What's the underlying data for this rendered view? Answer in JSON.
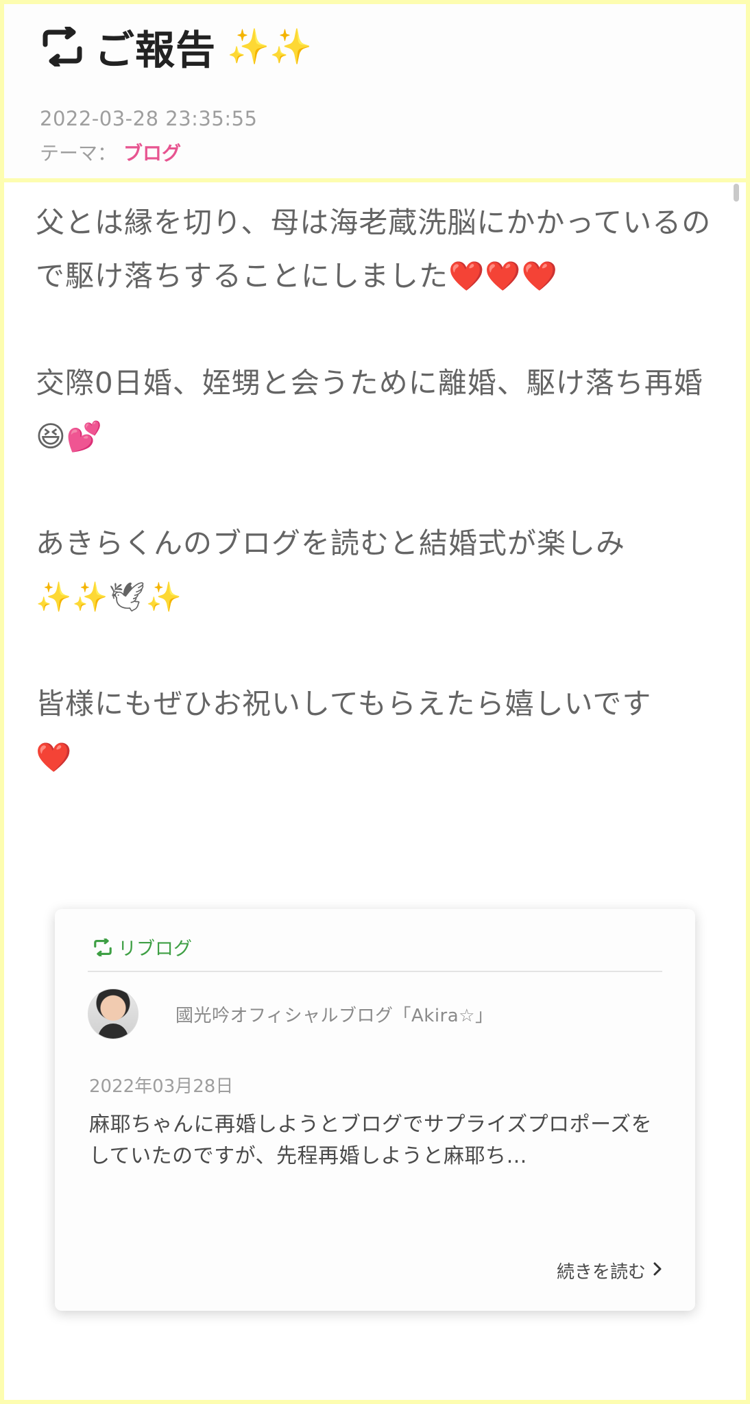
{
  "post": {
    "title": "ご報告",
    "title_sparkles": "✨✨",
    "date": "2022-03-28 23:35:55",
    "theme_label": "テーマ：",
    "theme_value": "ブログ"
  },
  "body": {
    "p1": "父とは縁を切り、母は海老蔵洗脳にかかっているので駆け落ちすることにしました",
    "p1_emoji": "❤️❤️❤️",
    "p2": "交際0日婚、姪甥と会うために離婚、駆け落ち再婚",
    "p2_emoji": "😆💕",
    "p3": "あきらくんのブログを読むと結婚式が楽しみ",
    "p3_emoji": "✨✨🕊✨",
    "p4": "皆様にもぜひお祝いしてもらえたら嬉しいです",
    "p4_emoji": "❤️"
  },
  "reblog": {
    "label": "リブログ",
    "author": "國光吟オフィシャルブログ「Akira☆」",
    "date": "2022年03月28日",
    "excerpt": "麻耶ちゃんに再婚しようとブログでサプライズプロポーズをしていたのですが、先程再婚しようと麻耶ち…",
    "read_more": "続きを読む"
  },
  "colors": {
    "frame": "#fdfdb0",
    "theme_link": "#e75490",
    "reblog_green": "#3e9f44"
  },
  "icons": {
    "title_icon": "reblog-icon",
    "reblog_icon": "reblog-icon",
    "read_more_icon": "chevron-right-icon"
  }
}
